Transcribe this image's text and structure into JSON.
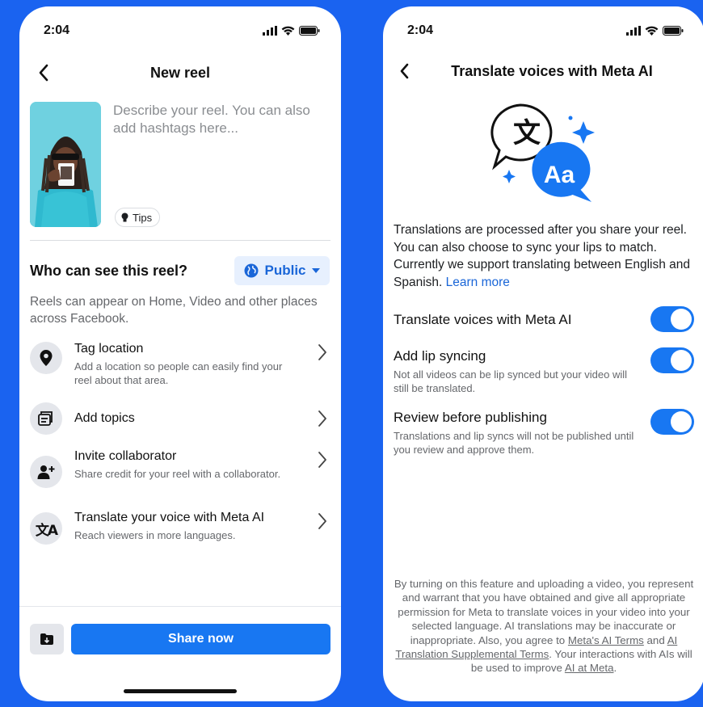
{
  "left_screen": {
    "status_time": "2:04",
    "title": "New reel",
    "description_placeholder": "Describe your reel. You can also add hashtags here...",
    "tips_label": "Tips",
    "audience_heading": "Who can see this reel?",
    "audience_value": "Public",
    "audience_note": "Reels can appear on Home, Video and other places across Facebook.",
    "options": [
      {
        "title": "Tag location",
        "subtitle": "Add a location so people can easily find your reel about that area.",
        "icon": "location-pin-icon"
      },
      {
        "title": "Add topics",
        "subtitle": "",
        "icon": "topics-icon"
      },
      {
        "title": "Invite collaborator",
        "subtitle": "Share credit for your reel with a collaborator.",
        "icon": "add-person-icon"
      },
      {
        "title": "Translate your voice with Meta AI",
        "subtitle": "Reach viewers in more languages.",
        "icon": "translate-icon"
      }
    ],
    "share_label": "Share now"
  },
  "right_screen": {
    "status_time": "2:04",
    "title": "Translate voices with Meta AI",
    "hero_glyph_cjk": "文",
    "hero_glyph_latin": "Aa",
    "info_text": "Translations are processed after you share your reel. You can also choose to sync your lips to match. Currently we support translating between English and Spanish.",
    "learn_more": "Learn more",
    "toggles": [
      {
        "title": "Translate voices with Meta AI",
        "subtitle": "",
        "on": true
      },
      {
        "title": "Add lip syncing",
        "subtitle": "Not all videos can be lip synced but your video will still be translated.",
        "on": true
      },
      {
        "title": "Review before publishing",
        "subtitle": "Translations and lip syncs will not be published until you review and approve them.",
        "on": true
      }
    ],
    "legal": {
      "part1": "By turning on this feature and uploading a video, you represent and warrant that you have obtained and give all appropriate permission for Meta to translate voices in your video into your selected language. AI translations may be inaccurate or inappropriate. Also, you agree to",
      "link1": "Meta's AI Terms",
      "and": "and",
      "link2": "AI Translation Supplemental Terms",
      "part2": ". Your interactions with AIs will be used to improve",
      "link3": "AI at Meta",
      "end": "."
    }
  },
  "colors": {
    "background": "#1a63f0",
    "accent": "#1877f2",
    "public_bg": "#e7f0fe"
  }
}
